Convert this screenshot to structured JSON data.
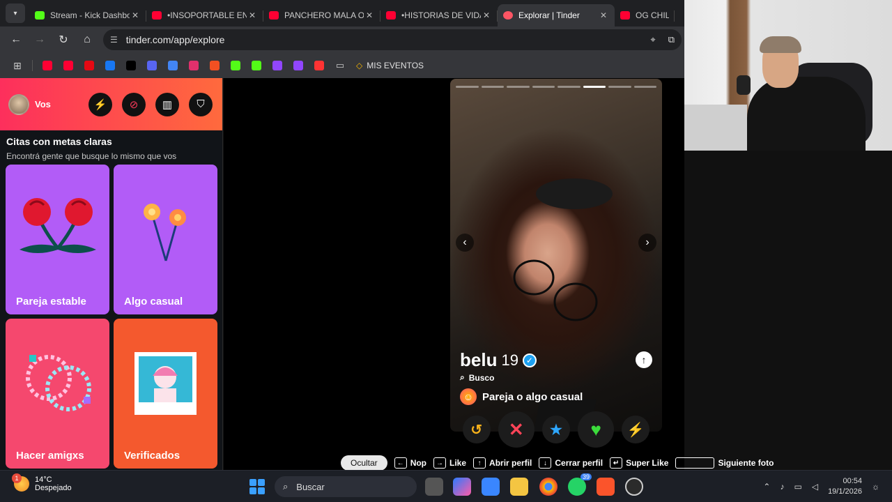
{
  "browser": {
    "tabs": [
      {
        "label": "Stream - Kick Dashboard",
        "color": "#53fc18"
      },
      {
        "label": "•INSOPORTABLE EN LA",
        "color": "#ff0033"
      },
      {
        "label": "PANCHERO MALA ONDA",
        "color": "#ff0033"
      },
      {
        "label": "•HISTORIAS DE VIDA",
        "color": "#ff0033"
      },
      {
        "label": "Explorar | Tinder",
        "color": "#fd5564",
        "active": true
      },
      {
        "label": "OG CHILL",
        "color": "#ff0033"
      }
    ],
    "url": "tinder.com/app/explore",
    "bookmark_folder": "MIS EVENTOS",
    "bookmark_colors": [
      "#ff0033",
      "#ff0033",
      "#e50914",
      "#1877f2",
      "#000000",
      "#5865f2",
      "#4285f4",
      "#e1306c",
      "#f25022",
      "#53fc18",
      "#53fc18",
      "#9146ff",
      "#9146ff",
      "#ff3333"
    ]
  },
  "sidebar": {
    "user": "Vos",
    "section_title": "Citas con metas claras",
    "section_subtitle": "Encontrá gente que busque lo mismo que vos",
    "cards": [
      {
        "label": "Pareja estable",
        "color": "#b25cf7"
      },
      {
        "label": "Algo casual",
        "color": "#b25cf7"
      },
      {
        "label": "Hacer amigxs",
        "color": "#f5486e"
      },
      {
        "label": "Verificados",
        "color": "#f4592e"
      }
    ]
  },
  "profile": {
    "name": "belu",
    "age": "19",
    "busco_label": "Busco",
    "goal": "Pareja o algo casual",
    "photo_count": 8,
    "current_photo": 6
  },
  "shortcuts": {
    "hide": "Ocultar",
    "nop": "Nop",
    "like": "Like",
    "open": "Abrir perfil",
    "close": "Cerrar perfil",
    "superlike": "Super Like",
    "next": "Siguiente foto"
  },
  "taskbar": {
    "temp": "14°C",
    "weather": "Despejado",
    "notif_count": "1",
    "search_placeholder": "Buscar",
    "whatsapp_badge": "39",
    "time": "00:54",
    "date": "19/1/2026"
  }
}
